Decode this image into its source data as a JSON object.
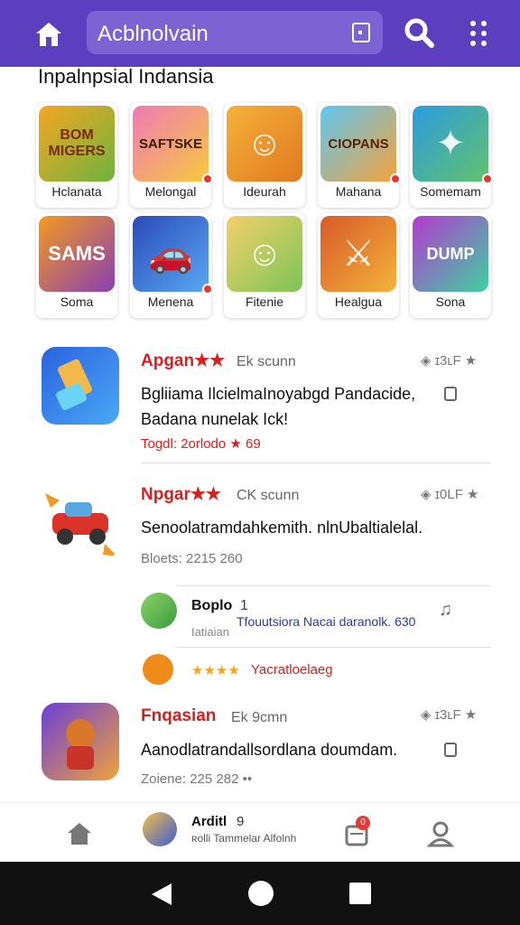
{
  "appbar": {
    "search_text": "Acblnolvain",
    "icons": {
      "home": "home-icon",
      "tab": "tab-switcher-icon",
      "search": "search-icon",
      "more": "more-vert-icon"
    }
  },
  "section": {
    "title": "Inpalnpsial Indansia"
  },
  "games": [
    {
      "label": "Hclanata",
      "art": "BOM MIGERS",
      "colors": [
        "#f4a623",
        "#6fb33f"
      ],
      "badge": false
    },
    {
      "label": "Melongal",
      "art": "SAFTSKE",
      "colors": [
        "#f07ab6",
        "#f6c93c"
      ],
      "badge": true
    },
    {
      "label": "Ideurah",
      "art": "",
      "colors": [
        "#f5b13a",
        "#e07a1f"
      ],
      "badge": false
    },
    {
      "label": "Mahana",
      "art": "CIOPANS",
      "colors": [
        "#5fc7f0",
        "#f2a23b"
      ],
      "badge": true
    },
    {
      "label": "Somemam",
      "art": "",
      "colors": [
        "#2c9be0",
        "#62c26b"
      ],
      "badge": true
    },
    {
      "label": "Soma",
      "art": "SAMS",
      "colors": [
        "#f39a1f",
        "#8a3fb0"
      ],
      "badge": false
    },
    {
      "label": "Menena",
      "art": "",
      "colors": [
        "#2a4ab8",
        "#59a8f3"
      ],
      "badge": true
    },
    {
      "label": "Fitenie",
      "art": "",
      "colors": [
        "#f4d06a",
        "#7cc457"
      ],
      "badge": false
    },
    {
      "label": "Healgua",
      "art": "",
      "colors": [
        "#d85a2a",
        "#f3b33a"
      ],
      "badge": false
    },
    {
      "label": "Sona",
      "art": "DUMP",
      "colors": [
        "#b43ad1",
        "#3bd1a0"
      ],
      "badge": false
    }
  ],
  "feed": [
    {
      "title": "Apgan★★",
      "author": "Ek scunn",
      "right": "◈ ɪ3ʟF ★",
      "desc": "Bgliiama IlcielmaInoyabgd Pandacide, Badana nunelak Ick!",
      "stats": "Togdl: 2orlodo ★ 69",
      "stats_red": true,
      "icon_colors": [
        "#2a62e0",
        "#4aa8f5"
      ]
    },
    {
      "title": "Npgar★★",
      "author": "CK scunn",
      "right": "◈ ɪ0LF ★",
      "desc": "Senoolatramdahkemith. nlnUbaltialelal.",
      "stats": "Bloets: 2215  260",
      "stats_red": false,
      "icon_colors": [
        "#ffffff",
        "#ffffff"
      ]
    },
    {
      "title": "Fnqasian",
      "author": "Ek 9cmn",
      "right": "◈ ɪ3ʟF ★",
      "desc": "Aanodlatrandallsordlana doumdam.",
      "stats": "Zoiene: 225  282  ••",
      "stats_red": false,
      "icon_colors": [
        "#6a3fd6",
        "#f0a23a"
      ]
    }
  ],
  "subitems": [
    {
      "name": "Boplo",
      "num": "1",
      "line": "Tfouutsiora Nacai daranolk. 630",
      "small": "Iatiaian"
    },
    {
      "stars": "★★★★",
      "text": "Yacratloelaeg"
    }
  ],
  "bottomnav": {
    "user_name": "Arditl",
    "user_num": "9",
    "user_sub": "ʀolli Tammelar Alfolnh",
    "badge": "0"
  },
  "colors": {
    "appbar": "#5b3fbf",
    "accent_red": "#d62020"
  }
}
